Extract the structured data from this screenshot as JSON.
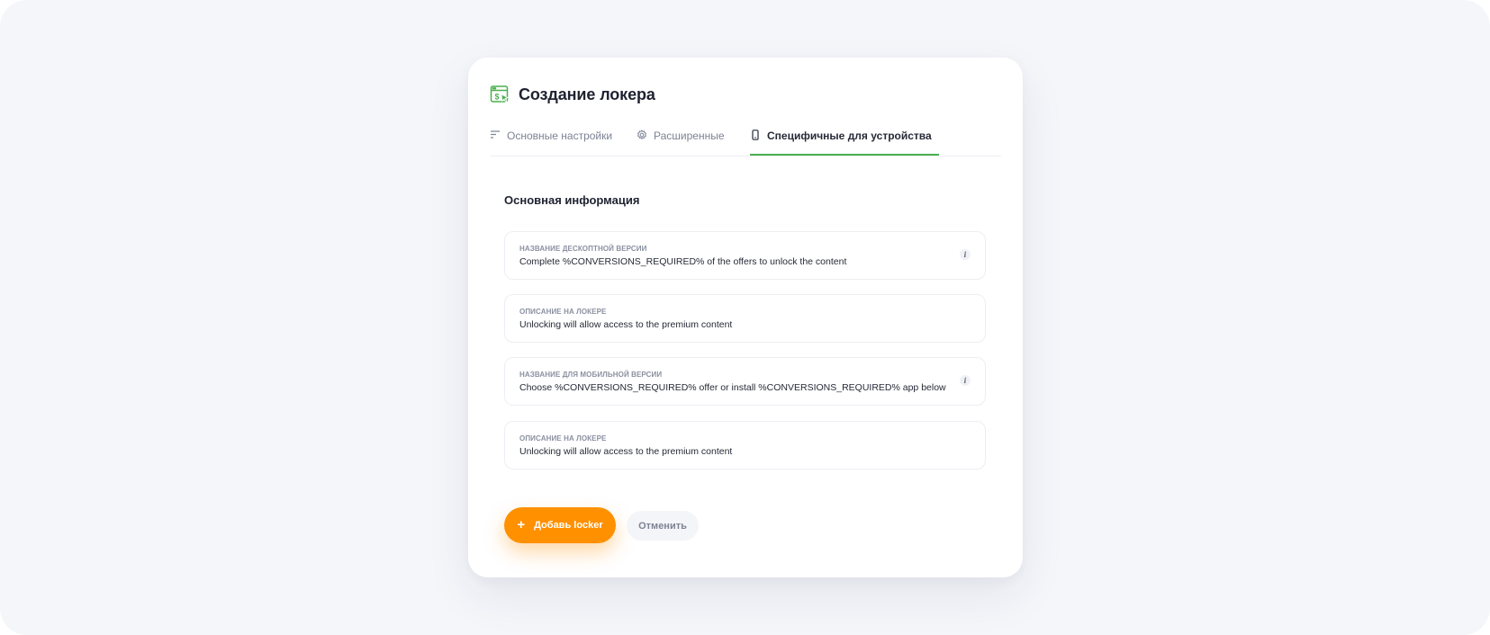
{
  "modal": {
    "title": "Создание локера",
    "logo_icon": "dollar-window-icon",
    "accent_color": "#4caf50"
  },
  "tabs": [
    {
      "label": "Основные настройки",
      "icon": "list-lines-icon",
      "active": false
    },
    {
      "label": "Расширенные",
      "icon": "gear-icon",
      "active": false
    },
    {
      "label": "Специфичные для устройства",
      "icon": "mobile-phone-icon",
      "active": true
    }
  ],
  "section": {
    "title": "Основная информация"
  },
  "fields": [
    {
      "label": "Название дескоптной версии",
      "value": "Complete %CONVERSIONS_REQUIRED% of the offers to unlock the content",
      "has_info": true
    },
    {
      "label": "Описание на локере",
      "value": "Unlocking will allow access to the premium content",
      "has_info": false
    },
    {
      "label": "Название для мобильной версии",
      "value": "Choose %CONVERSIONS_REQUIRED% offer or install %CONVERSIONS_REQUIRED% app below",
      "has_info": true
    },
    {
      "label": "Описание на локере",
      "value": "Unlocking will allow access to the premium content",
      "has_info": false
    }
  ],
  "info_icon_glyph": "i",
  "actions": {
    "add_glyph": "+",
    "add_label": "Добавь locker",
    "add_color": "#ff9000",
    "cancel_label": "Отменить"
  }
}
